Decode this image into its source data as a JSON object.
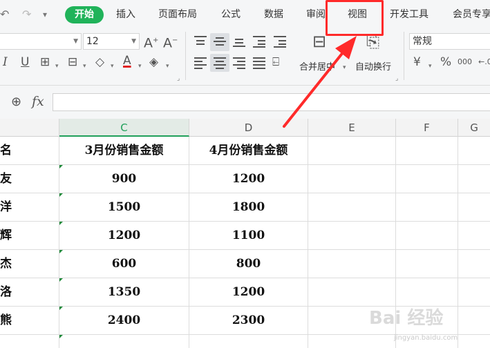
{
  "menubar": {
    "tabs": [
      "开始",
      "插入",
      "页面布局",
      "公式",
      "数据",
      "审阅",
      "视图",
      "开发工具",
      "会员专享"
    ]
  },
  "ribbon": {
    "font_size": "12",
    "number_format": "常规",
    "merge_label": "合并居中",
    "wrap_label": "自动换行",
    "currency_symbol": "¥",
    "percent_symbol": "%",
    "thousands_symbol": "000"
  },
  "formula": {
    "fx": "fx",
    "value": ""
  },
  "columns": [
    "C",
    "D",
    "E",
    "F",
    "G"
  ],
  "table": {
    "headers": [
      "名",
      "3月份销售金额",
      "4月份销售金额"
    ],
    "rows": [
      [
        "友",
        "900",
        "1200"
      ],
      [
        "洋",
        "1500",
        "1800"
      ],
      [
        "辉",
        "1200",
        "1100"
      ],
      [
        "杰",
        "600",
        "800"
      ],
      [
        "洛",
        "1350",
        "1200"
      ],
      [
        "熊",
        "2400",
        "2300"
      ],
      [
        "",
        "",
        ""
      ]
    ]
  },
  "watermark": {
    "main": "Bai 经验",
    "sub": "jingyan.baidu.com"
  },
  "colors": {
    "accent_green": "#20b35a",
    "highlight_red": "#ff2a2a"
  }
}
